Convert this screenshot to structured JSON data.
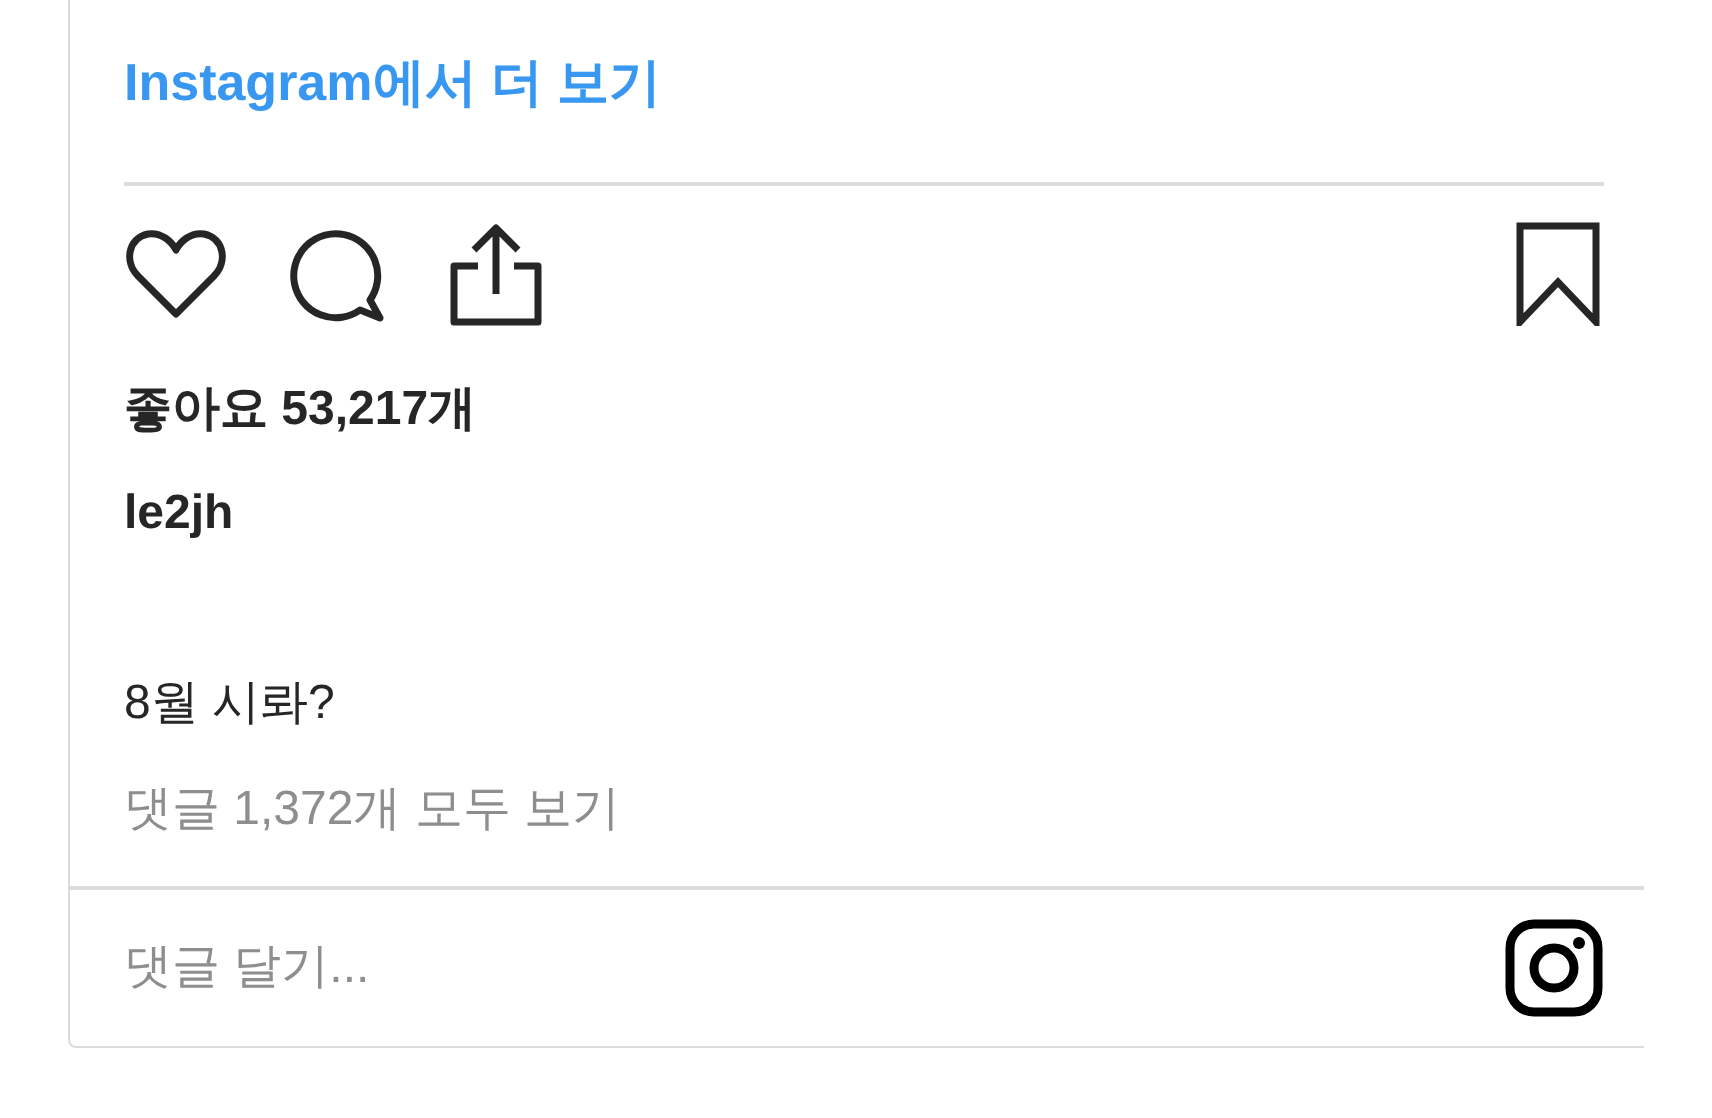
{
  "view_more_link": "Instagram에서 더 보기",
  "actions": {
    "liked": false,
    "saved": false
  },
  "likes": "좋아요 53,217개",
  "username": "le2jh",
  "caption": "8월 시롸?",
  "view_comments": "댓글 1,372개 모두 보기",
  "comment_field": {
    "placeholder": "댓글 달기..."
  }
}
